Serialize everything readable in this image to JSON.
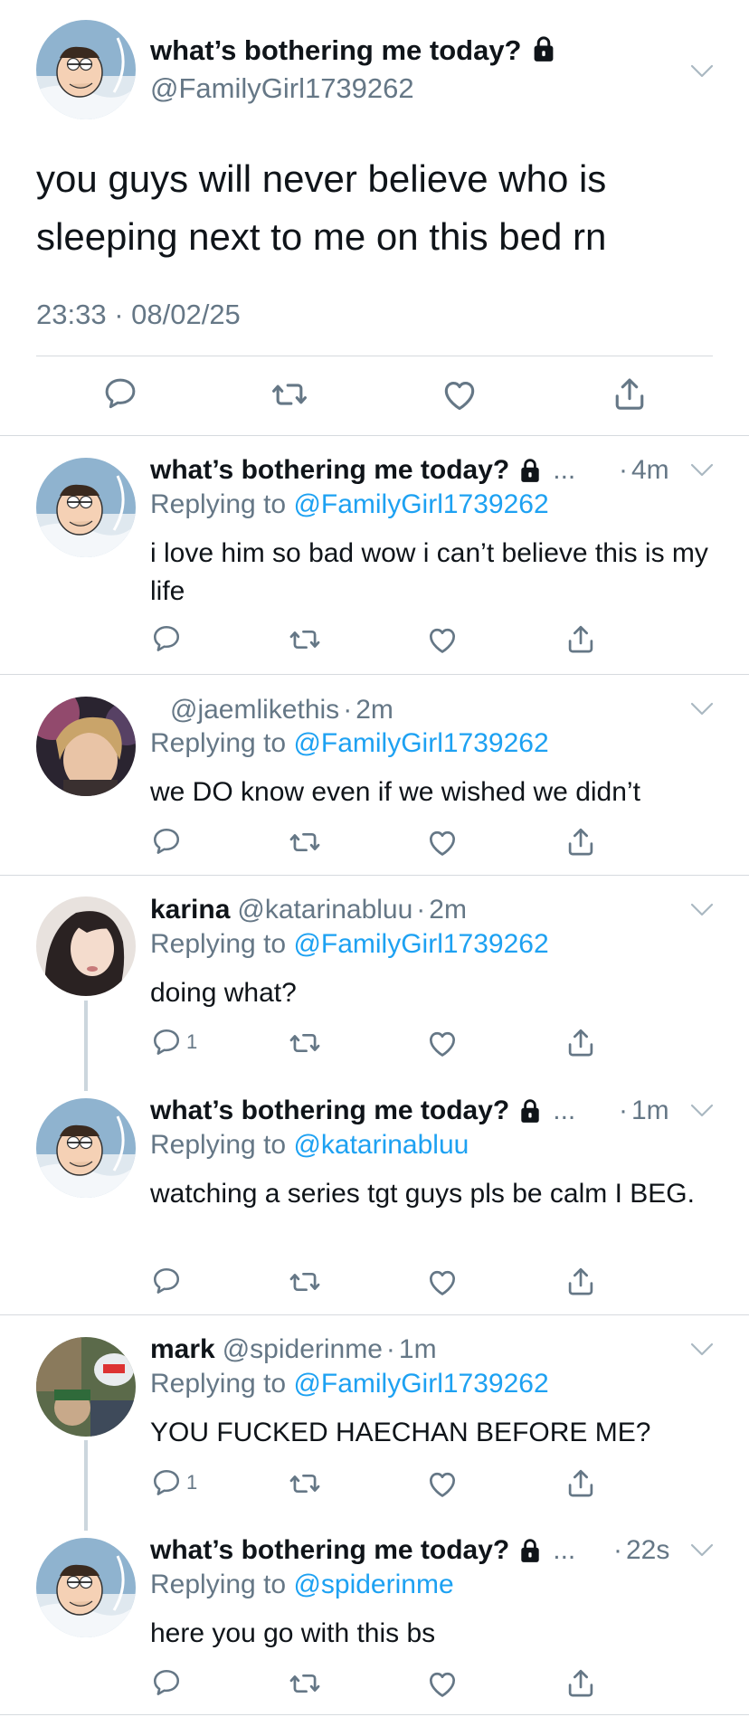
{
  "main_tweet": {
    "name": "what’s bothering me today?",
    "handle": "@FamilyGirl1739262",
    "text": "you guys will never believe who is sleeping next to me on this bed rn",
    "timestamp": "23:33 · 08/02/25"
  },
  "replies": [
    {
      "name": "what’s bothering me today?",
      "handle": "",
      "ellipsis": "...",
      "time": "4m",
      "replying_prefix": "Replying to",
      "replying_to": "@FamilyGirl1739262",
      "text": "i love him so bad wow i can’t believe this is my life",
      "reply_count": ""
    },
    {
      "name": "",
      "handle": "@jaemlikethis",
      "ellipsis": "",
      "time": "2m",
      "replying_prefix": "Replying to",
      "replying_to": "@FamilyGirl1739262",
      "text": "we DO know even if we wished we didn’t",
      "reply_count": ""
    },
    {
      "name": "karina",
      "handle": "@katarinabluu",
      "ellipsis": "",
      "time": "2m",
      "replying_prefix": "Replying to",
      "replying_to": "@FamilyGirl1739262",
      "text": "doing what?",
      "reply_count": "1"
    },
    {
      "name": "what’s bothering me today?",
      "handle": "",
      "ellipsis": "...",
      "time": "1m",
      "replying_prefix": "Replying to",
      "replying_to": "@katarinabluu",
      "text": "watching a series tgt guys pls be calm I BEG.",
      "reply_count": ""
    },
    {
      "name": "mark",
      "handle": "@spiderinme",
      "ellipsis": "",
      "time": "1m",
      "replying_prefix": "Replying to",
      "replying_to": "@FamilyGirl1739262",
      "text": "YOU FUCKED HAECHAN BEFORE ME?",
      "reply_count": "1"
    },
    {
      "name": "what’s bothering me today?",
      "handle": "",
      "ellipsis": "...",
      "time": "22s",
      "replying_prefix": "Replying to",
      "replying_to": "@spiderinme",
      "text": "here you go with this bs",
      "reply_count": ""
    }
  ],
  "time_separator": "·",
  "colors": {
    "text": "#0f1419",
    "secondary": "#657786",
    "link": "#1da1f2",
    "divider": "#d6dade",
    "thread_line": "#ccd6dd"
  },
  "icons": [
    "chevron-down-icon",
    "lock-icon",
    "reply-icon",
    "retweet-icon",
    "like-icon",
    "share-icon"
  ]
}
